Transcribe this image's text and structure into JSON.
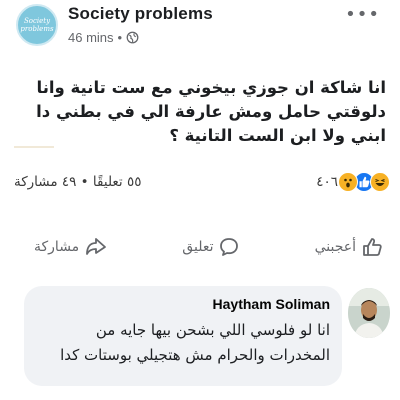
{
  "post": {
    "page_name": "Society problems",
    "avatar_text_line1": "Society",
    "avatar_text_line2": "problems",
    "timestamp": "46 mins",
    "separator": "•",
    "more_label": "•••",
    "text": "انا شاكة ان جوزي بيخوني مع ست تانية وانا دلوقتي حامل ومش عارفة الي في بطني دا ابني ولا ابن الست التانية ؟"
  },
  "stats": {
    "comments_shares": "٥٥ تعليقًا • ٤٩ مشاركة",
    "reaction_count": "٤٠٦",
    "reactions": [
      "haha-icon",
      "like-icon",
      "wow-icon"
    ]
  },
  "actions": {
    "like_label": "أعجبني",
    "comment_label": "تعليق",
    "share_label": "مشاركة"
  },
  "comment": {
    "author": "Haytham Soliman",
    "text": "انا لو فلوسي اللي بشحن بيها جايه من المخدرات والحرام مش هتجيلي بوستات كدا"
  },
  "colors": {
    "icon_gray": "#65676b",
    "like_blue": "#1877f2",
    "reaction_yellow": "#f7b125",
    "bubble_bg": "#f0f2f5"
  }
}
